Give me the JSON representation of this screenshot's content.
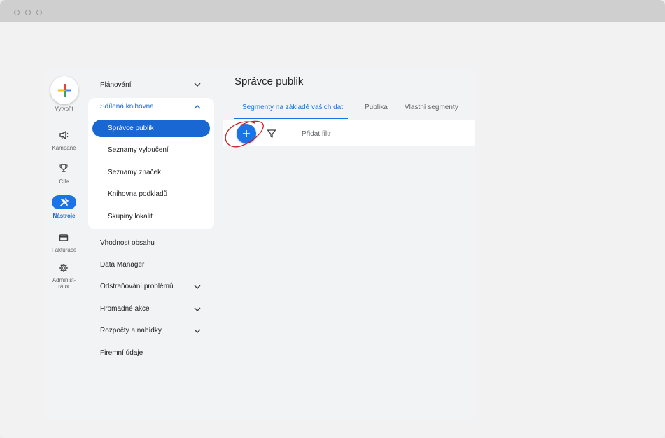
{
  "window": {
    "controls": [
      "close",
      "minimize",
      "maximize"
    ]
  },
  "rail": {
    "create_label": "Vytvořit",
    "items": [
      {
        "label": "Kampaně",
        "icon": "megaphone-icon"
      },
      {
        "label": "Cíle",
        "icon": "trophy-icon"
      },
      {
        "label": "Nástroje",
        "icon": "tools-icon",
        "active": true
      },
      {
        "label": "Fakturace",
        "icon": "card-icon"
      },
      {
        "label": "Administ-\nrátor",
        "icon": "gear-icon"
      }
    ]
  },
  "nav": {
    "planning": "Plánování",
    "shared_library": "Sdílená knihovna",
    "library_items": [
      "Správce publik",
      "Seznamy vyloučení",
      "Seznamy značek",
      "Knihovna podkladů",
      "Skupiny lokalit"
    ],
    "items": [
      "Vhodnost obsahu",
      "Data Manager",
      "Odstraňování problémů",
      "Hromadné akce",
      "Rozpočty a nabídky",
      "Firemní údaje"
    ]
  },
  "main": {
    "title": "Správce publik",
    "tabs": [
      "Segmenty na základě vašich dat",
      "Publika",
      "Vlastní segmenty"
    ],
    "active_tab": 0,
    "add_filter": "Přidat filtr"
  },
  "colors": {
    "accent": "#1a73e8",
    "active_nav": "#1967d2",
    "annotation": "#c5221f"
  }
}
